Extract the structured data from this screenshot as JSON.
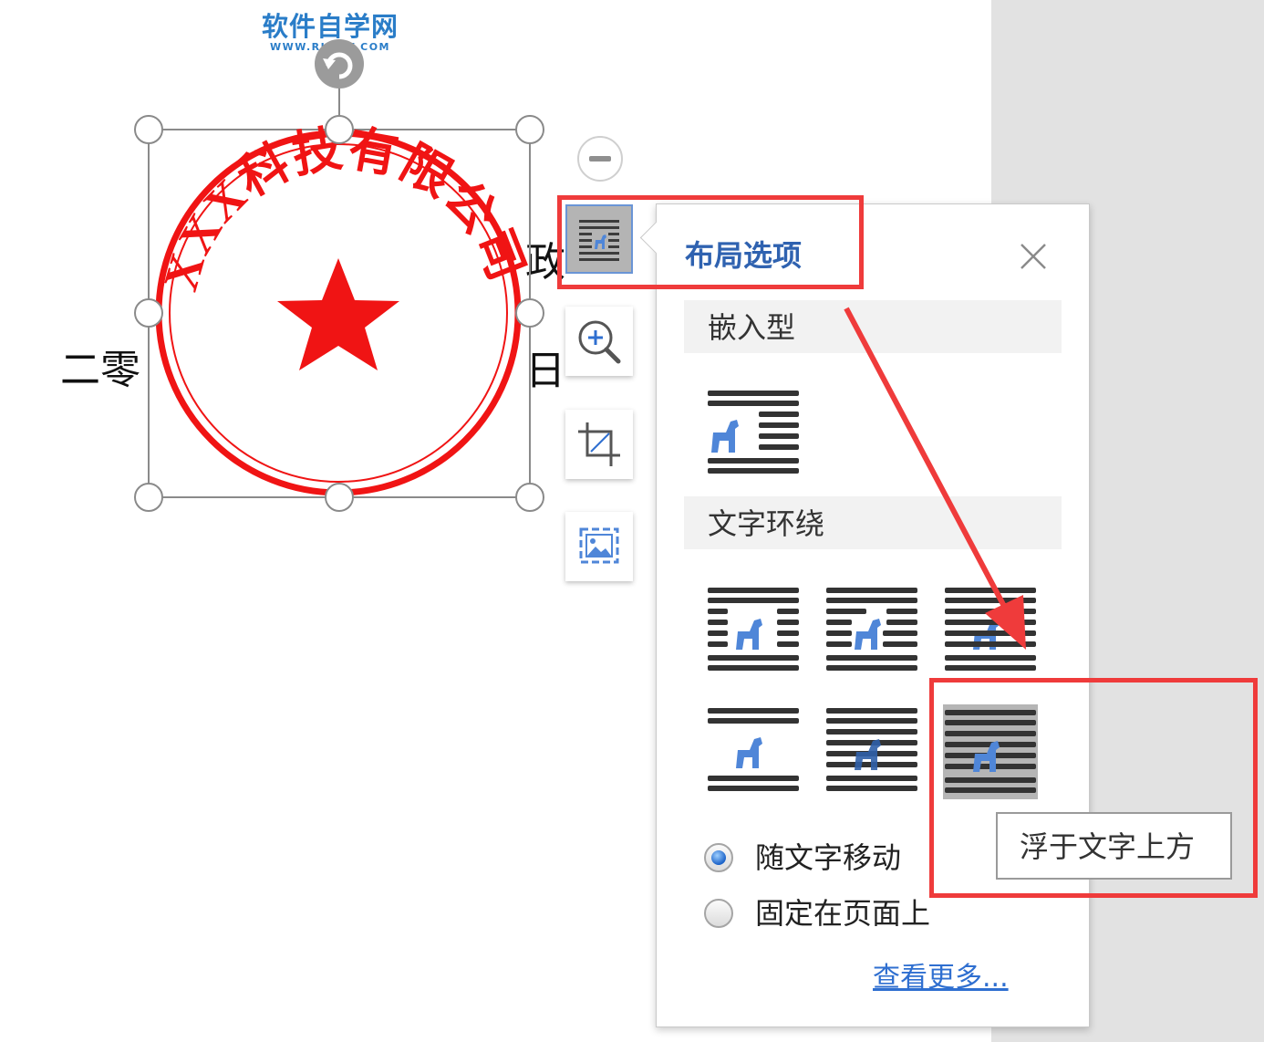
{
  "watermark": {
    "title": "软件自学网",
    "url": "WWW.RJZXW.COM"
  },
  "document": {
    "text_left": "二零",
    "text_right_top": "政",
    "text_right_bottom": "日"
  },
  "seal": {
    "company_text": "XXX科技有限公司",
    "color": "#f01414"
  },
  "toolbar": {
    "icons": [
      "collapse-icon",
      "layout-options-icon",
      "zoom-in-icon",
      "crop-icon",
      "change-picture-icon"
    ]
  },
  "layout_panel": {
    "title": "布局选项",
    "inline_section": "嵌入型",
    "wrap_section": "文字环绕",
    "radio_move_with_text": "随文字移动",
    "radio_fix_on_page": "固定在页面上",
    "see_more": "查看更多...",
    "tooltip": "浮于文字上方",
    "selected_option": "浮于文字上方"
  },
  "colors": {
    "accent": "#2f62b0",
    "highlight": "#ef3b3b",
    "horse_icon": "#4f86d8"
  }
}
